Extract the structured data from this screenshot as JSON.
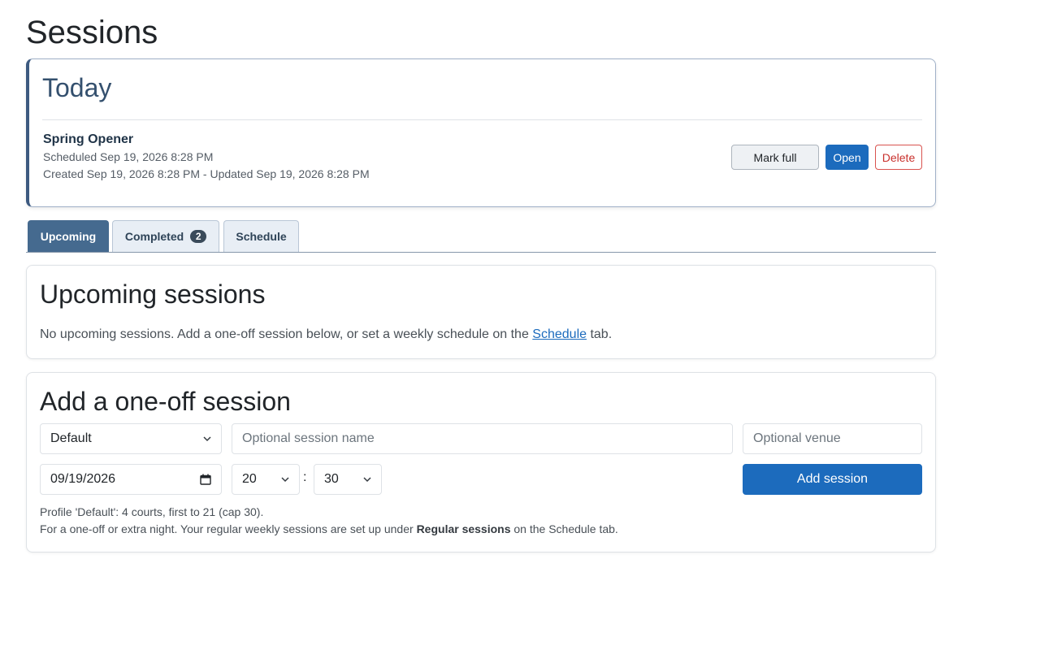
{
  "page": {
    "title": "Sessions"
  },
  "today": {
    "title": "Today",
    "session": {
      "name": "Spring Opener",
      "scheduled": "Scheduled Sep 19, 2026 8:28 PM",
      "created": "Created Sep 19, 2026 8:28 PM - Updated Sep 19, 2026 8:28 PM"
    },
    "actions": {
      "mark_full": "Mark full",
      "open": "Open",
      "delete": "Delete"
    }
  },
  "tabs": {
    "upcoming": "Upcoming",
    "completed": "Completed",
    "completed_count": "2",
    "schedule": "Schedule",
    "active": "Upcoming"
  },
  "upcoming": {
    "title": "Upcoming sessions",
    "empty_before": "No upcoming sessions. Add a one-off session below, or set a weekly schedule on the ",
    "empty_link": "Schedule",
    "empty_after": " tab."
  },
  "add": {
    "title": "Add a one-off session",
    "profile_value": "Default",
    "name_placeholder": "Optional session name",
    "venue_placeholder": "Optional venue",
    "date_value": "09/19/2026",
    "hour_value": "20",
    "time_separator": ":",
    "minute_value": "30",
    "submit_label": "Add session",
    "help_line1": "Profile 'Default': 4 courts, first to 21 (cap 30).",
    "help_line2_before": "For a one-off or extra night. Your regular weekly sessions are set up under ",
    "help_line2_bold": "Regular sessions",
    "help_line2_after": " on the Schedule tab."
  },
  "colors": {
    "primary": "#1c6bbd",
    "tab_active": "#456a8f",
    "today_accent": "#3d5a80",
    "danger": "#c9302c"
  },
  "icons": {
    "select_caret": "chevron-down-icon",
    "date_picker": "calendar-icon"
  }
}
